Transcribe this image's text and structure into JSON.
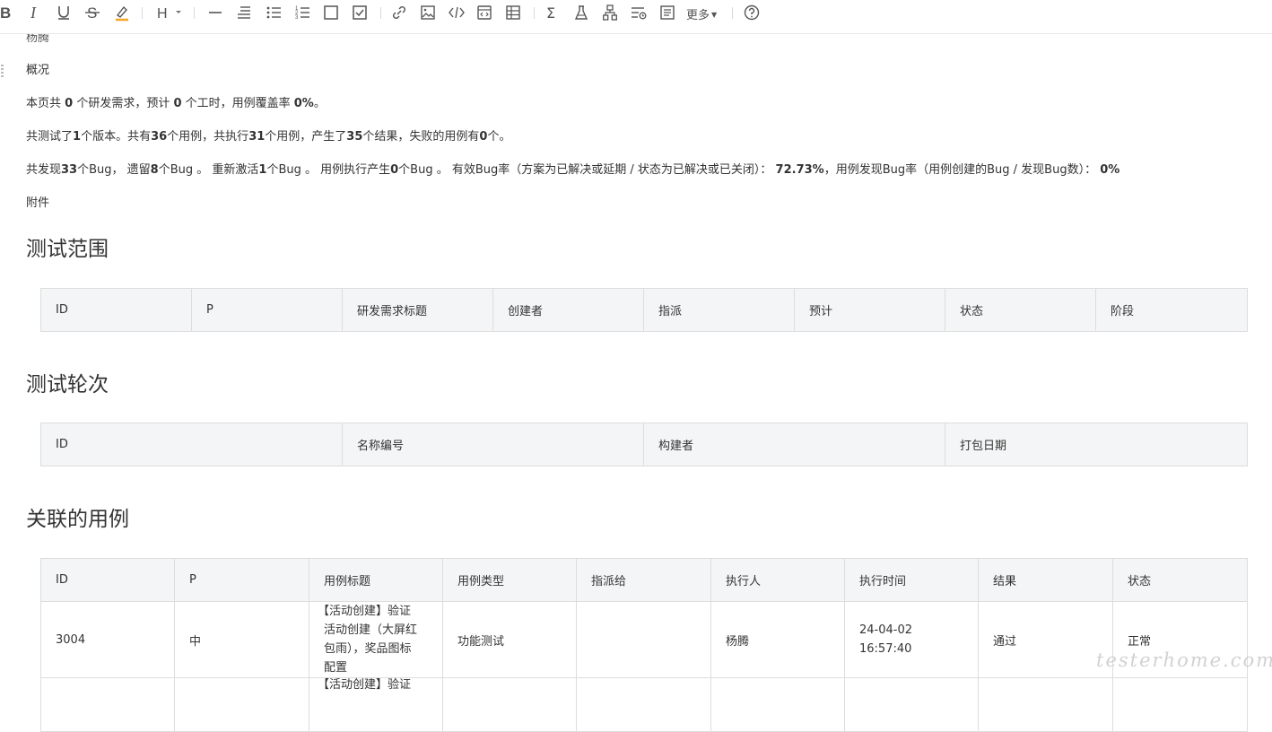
{
  "toolbar": {
    "more_label": "更多",
    "icons": [
      "bold-icon",
      "italic-icon",
      "underline-icon",
      "strikethrough-icon",
      "highlight-icon",
      "heading-icon",
      "horizontal-rule-icon",
      "quote-icon",
      "bullet-list-icon",
      "ordered-list-icon",
      "checkbox-empty-icon",
      "checkbox-checked-icon",
      "link-icon",
      "image-icon",
      "code-icon",
      "code-block-icon",
      "table-icon",
      "formula-icon",
      "flask-icon",
      "mindmap-icon",
      "toc-icon",
      "document-icon",
      "help-icon"
    ]
  },
  "doc": {
    "author_cut": "杨腾",
    "overview_title": "概况",
    "line1": {
      "a": "本页共 ",
      "b1": "0",
      "c": " 个研发需求，预计 ",
      "b2": "0",
      "d": " 个工时，用例覆盖率 ",
      "b3": "0%",
      "e": "。"
    },
    "line2": {
      "a": "共测试了",
      "b1": "1",
      "c": "个版本。共有",
      "b2": "36",
      "d": "个用例，共执行",
      "b3": "31",
      "e": "个用例，产生了",
      "b4": "35",
      "f": "个结果，失败的用例有",
      "b5": "0",
      "g": "个。"
    },
    "line3": {
      "a": "共发现",
      "b1": "33",
      "c": "个Bug， 遗留",
      "b2": "8",
      "d": "个Bug 。 重新激活",
      "b3": "1",
      "e": "个Bug 。 用例执行产生",
      "b4": "0",
      "f": "个Bug 。 有效Bug率（方案为已解决或延期 / 状态为已解决或已关闭）： ",
      "b5": "72.73%",
      "g": "，用例发现Bug率（用例创建的Bug / 发现Bug数）： ",
      "b6": "0%"
    },
    "attachment": "附件"
  },
  "scope": {
    "title": "测试范围",
    "headers": [
      "ID",
      "P",
      "研发需求标题",
      "创建者",
      "指派",
      "预计",
      "状态",
      "阶段"
    ]
  },
  "rounds": {
    "title": "测试轮次",
    "headers": [
      "ID",
      "名称编号",
      "构建者",
      "打包日期"
    ]
  },
  "cases": {
    "title": "关联的用例",
    "headers": [
      "ID",
      "P",
      "用例标题",
      "用例类型",
      "指派给",
      "执行人",
      "执行时间",
      "结果",
      "状态"
    ],
    "rows": [
      {
        "id": "3004",
        "p": "中",
        "title_lines": [
          "【活动创建】验证",
          "活动创建（大屏红",
          "包雨），奖品图标",
          "配置"
        ],
        "type": "功能测试",
        "assignee": "",
        "executor": "杨腾",
        "time_lines": [
          "24-04-02",
          "16:57:40"
        ],
        "result": "通过",
        "status": "正常"
      },
      {
        "id": "",
        "p": "",
        "title_lines": [
          "【活动创建】验证"
        ],
        "type": "",
        "assignee": "",
        "executor": "",
        "time_lines": [],
        "result": "",
        "status": ""
      }
    ]
  },
  "watermark": "testerhome.com"
}
